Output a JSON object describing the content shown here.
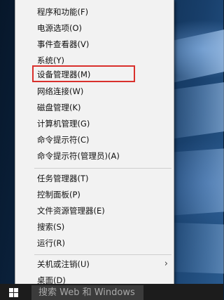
{
  "menu": {
    "items": [
      {
        "label": "程序和功能(F)"
      },
      {
        "label": "电源选项(O)"
      },
      {
        "label": "事件查看器(V)"
      },
      {
        "label": "系统(Y)"
      },
      {
        "label": "设备管理器(M)"
      },
      {
        "label": "网络连接(W)"
      },
      {
        "label": "磁盘管理(K)"
      },
      {
        "label": "计算机管理(G)"
      },
      {
        "label": "命令提示符(C)"
      },
      {
        "label": "命令提示符(管理员)(A)"
      },
      {
        "label": "任务管理器(T)"
      },
      {
        "label": "控制面板(P)"
      },
      {
        "label": "文件资源管理器(E)"
      },
      {
        "label": "搜索(S)"
      },
      {
        "label": "运行(R)"
      },
      {
        "label": "关机或注销(U)",
        "has_submenu": true
      },
      {
        "label": "桌面(D)"
      }
    ],
    "highlighted_item": "设备管理器(M)",
    "highlight_color": "#d9302c"
  },
  "taskbar": {
    "search_text": "搜索 Web 和 Windows",
    "start_icon": "windows-logo-icon"
  }
}
